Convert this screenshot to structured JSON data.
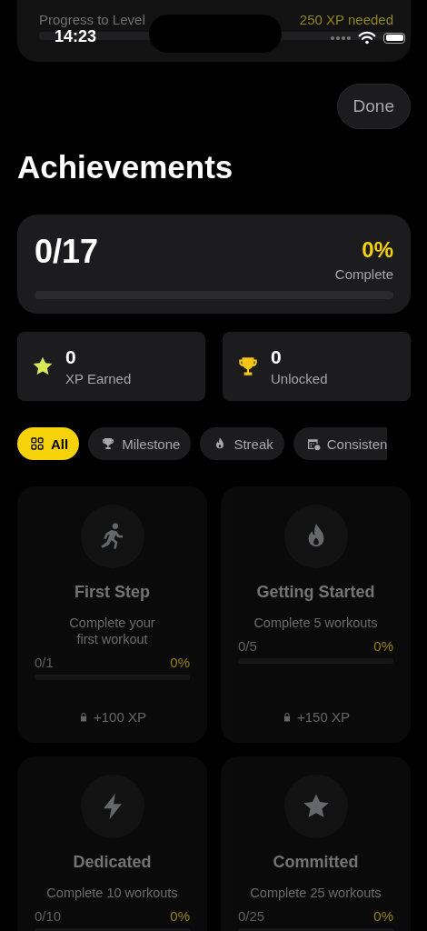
{
  "status_bar": {
    "time": "14:23"
  },
  "level_card": {
    "label": "Progress to Level",
    "needed": "250 XP needed",
    "level": 0
  },
  "done_button": "Done",
  "title": "Achievements",
  "summary": {
    "count": "0/17",
    "percent": "0%",
    "percent_label": "Complete",
    "level": 0
  },
  "stats": [
    {
      "kind": "xp",
      "value": "0",
      "label": "XP Earned"
    },
    {
      "kind": "unlocked",
      "value": "0",
      "label": "Unlocked"
    }
  ],
  "filters": [
    {
      "kind": "all",
      "label": "All",
      "selected": true
    },
    {
      "kind": "milestone",
      "label": "Milestone",
      "selected": false
    },
    {
      "kind": "streak",
      "label": "Streak",
      "selected": false
    },
    {
      "kind": "consistency",
      "label": "Consisten",
      "selected": false
    }
  ],
  "achievements": [
    {
      "kind": "run",
      "title": "First Step",
      "description": "Complete your first workout",
      "progress": "0/1",
      "percent": "0%",
      "level": 0,
      "reward": "+100 XP",
      "locked": true
    },
    {
      "kind": "flame",
      "title": "Getting Started",
      "description": "Complete 5 workouts",
      "progress": "0/5",
      "percent": "0%",
      "level": 0,
      "reward": "+150 XP",
      "locked": true
    },
    {
      "kind": "bolt",
      "title": "Dedicated",
      "description": "Complete 10 workouts",
      "progress": "0/10",
      "percent": "0%",
      "level": 0,
      "locked": true
    },
    {
      "kind": "star",
      "title": "Committed",
      "description": "Complete 25 workouts",
      "progress": "0/25",
      "percent": "0%",
      "level": 0,
      "locked": true
    }
  ]
}
